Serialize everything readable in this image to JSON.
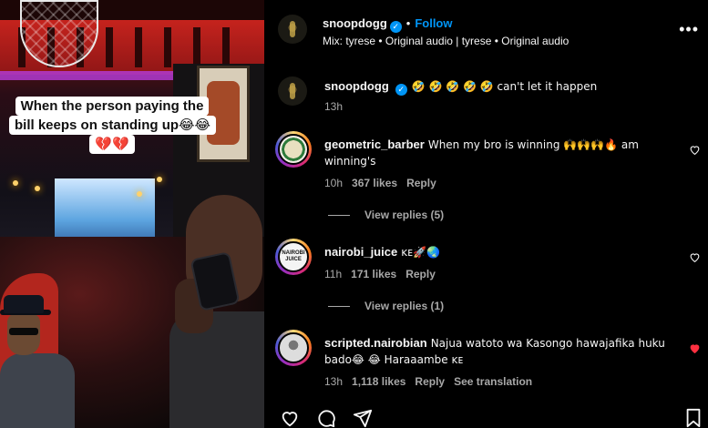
{
  "video": {
    "caption": "When the person paying the bill keeps on standing up😂😂💔💔"
  },
  "header": {
    "username": "snoopdogg",
    "follow_label": "Follow",
    "audio": "Mix: tyrese • Original audio | tyrese • Original audio",
    "more_icon": "more-horizontal-icon"
  },
  "post": {
    "username": "snoopdogg",
    "text": "🤣 🤣 🤣 🤣 🤣 can't let it happen",
    "time": "13h"
  },
  "comments": [
    {
      "username": "geometric_barber",
      "text_line1": "When my bro is winning 🙌🙌🙌🔥 am",
      "text_line2": "winning's",
      "time": "10h",
      "likes": "367 likes",
      "reply": "Reply",
      "view_replies": "View replies (5)",
      "liked": false
    },
    {
      "username": "nairobi_juice",
      "avatar_text": "NAIROBI JUICE",
      "text": "ᴋᴇ🚀🌏",
      "time": "11h",
      "likes": "171 likes",
      "reply": "Reply",
      "view_replies": "View replies (1)",
      "liked": false
    },
    {
      "username": "scripted.nairobian",
      "text_line1": "Najua watoto wa Kasongo hawajafika huku",
      "text_line2": "bado😂 😂 Haraaambe ᴋᴇ",
      "time": "13h",
      "likes": "1,118 likes",
      "reply": "Reply",
      "see_translation": "See translation",
      "liked": true
    }
  ],
  "colors": {
    "accent": "#0095f6",
    "heart_liked": "#ff3040",
    "muted": "#a8a8a8"
  },
  "actions": [
    "like-icon",
    "comment-icon",
    "share-icon",
    "save-icon"
  ]
}
